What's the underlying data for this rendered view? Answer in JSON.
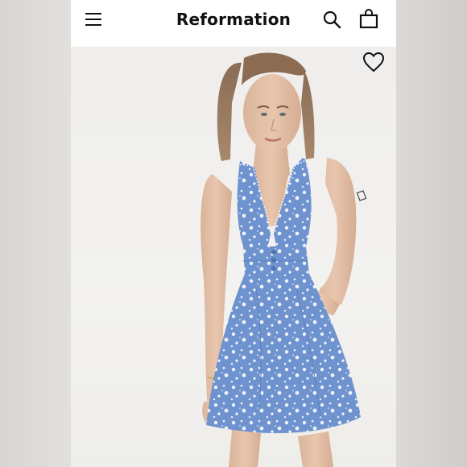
{
  "header": {
    "brand": "Reformation",
    "icons": [
      "menu-icon",
      "search-icon",
      "shopping-bag-icon"
    ]
  },
  "product": {
    "image": "model-in-blue-floral-mini-dress",
    "favorite_icon": "heart-icon"
  },
  "colors": {
    "header_bg": "#ffffff",
    "text": "#111111",
    "dress_blue": "#6e93cf",
    "background": "#f2f1ef"
  }
}
